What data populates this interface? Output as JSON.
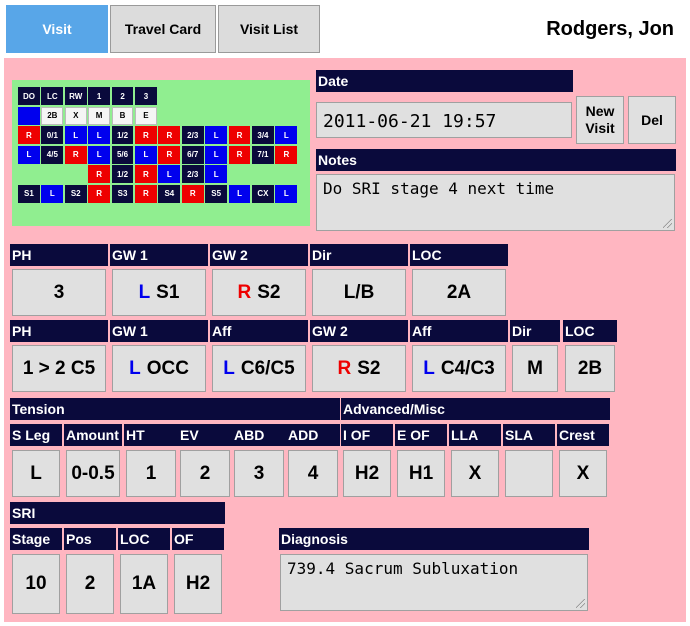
{
  "tabs": [
    "Visit",
    "Travel Card",
    "Visit List"
  ],
  "patient_name": "Rodgers, Jon",
  "travel_card": {
    "rows": [
      [
        [
          "DO",
          "dk"
        ],
        [
          "LC",
          "dk"
        ],
        [
          "RW",
          "dk"
        ],
        [
          "1",
          "dk"
        ],
        [
          "2",
          "dk"
        ],
        [
          "3",
          "dk"
        ]
      ],
      [
        [
          "",
          "bl"
        ],
        [
          "2B",
          "wh"
        ],
        [
          "X",
          "wh"
        ],
        [
          "M",
          "wh"
        ],
        [
          "B",
          "wh"
        ],
        [
          "E",
          "wh"
        ]
      ],
      [
        [
          "R",
          "rd"
        ],
        [
          "0/1",
          "dk"
        ],
        [
          "L",
          "bl"
        ],
        [
          "L",
          "bl"
        ],
        [
          "1/2",
          "dk"
        ],
        [
          "R",
          "rd"
        ],
        [
          "R",
          "rd"
        ],
        [
          "2/3",
          "dk"
        ],
        [
          "L",
          "bl"
        ],
        [
          "R",
          "rd"
        ],
        [
          "3/4",
          "dk"
        ],
        [
          "L",
          "bl"
        ]
      ],
      [
        [
          "L",
          "bl"
        ],
        [
          "4/5",
          "dk"
        ],
        [
          "R",
          "rd"
        ],
        [
          "L",
          "bl"
        ],
        [
          "5/6",
          "dk"
        ],
        [
          "L",
          "bl"
        ],
        [
          "R",
          "rd"
        ],
        [
          "6/7",
          "dk"
        ],
        [
          "L",
          "bl"
        ],
        [
          "R",
          "rd"
        ],
        [
          "7/1",
          "dk"
        ],
        [
          "R",
          "rd"
        ]
      ],
      [
        null,
        null,
        null,
        [
          "R",
          "rd"
        ],
        [
          "1/2",
          "dk"
        ],
        [
          "R",
          "rd"
        ],
        [
          "L",
          "bl"
        ],
        [
          "2/3",
          "dk"
        ],
        [
          "L",
          "bl"
        ],
        null,
        null,
        null
      ],
      [
        [
          "S1",
          "dk"
        ],
        [
          "L",
          "bl"
        ],
        [
          "S2",
          "dk"
        ],
        [
          "R",
          "rd"
        ],
        [
          "S3",
          "dk"
        ],
        [
          "R",
          "rd"
        ],
        [
          "S4",
          "dk"
        ],
        [
          "R",
          "rd"
        ],
        [
          "S5",
          "dk"
        ],
        [
          "L",
          "bl"
        ],
        [
          "CX",
          "dk"
        ],
        [
          "L",
          "bl"
        ]
      ]
    ]
  },
  "date": {
    "label": "Date",
    "value": "2011-06-21 19:57"
  },
  "buttons": {
    "new_visit_line1": "New",
    "new_visit_line2": "Visit",
    "del": "Del"
  },
  "notes": {
    "label": "Notes",
    "value": "Do SRI stage 4 next time"
  },
  "row1": [
    {
      "header": "PH",
      "side": "",
      "value": "3"
    },
    {
      "header": "GW 1",
      "side": "L",
      "value": "S1"
    },
    {
      "header": "GW 2",
      "side": "R",
      "value": "S2"
    },
    {
      "header": "Dir",
      "side": "",
      "value": "L/B"
    },
    {
      "header": "LOC",
      "side": "",
      "value": "2A"
    }
  ],
  "row2": [
    {
      "header": "PH",
      "side": "",
      "value": "1 > 2 C5"
    },
    {
      "header": "GW 1",
      "side": "L",
      "value": "OCC"
    },
    {
      "header": "Aff",
      "side": "L",
      "value": "C6/C5"
    },
    {
      "header": "GW 2",
      "side": "R",
      "value": "S2"
    },
    {
      "header": "Aff",
      "side": "L",
      "value": "C4/C3"
    },
    {
      "header": "Dir",
      "side": "",
      "value": "M"
    },
    {
      "header": "LOC",
      "side": "",
      "value": "2B"
    }
  ],
  "tension": {
    "label": "Tension",
    "cols": [
      {
        "header": "S Leg",
        "value": "L"
      },
      {
        "header": "Amount",
        "value": "0-0.5"
      },
      {
        "header": "HT",
        "value": "1"
      },
      {
        "header": "EV",
        "value": "2"
      },
      {
        "header": "ABD",
        "value": "3"
      },
      {
        "header": "ADD",
        "value": "4"
      }
    ]
  },
  "advanced": {
    "label": "Advanced/Misc",
    "cols": [
      {
        "header": "I OF",
        "value": "H2"
      },
      {
        "header": "E OF",
        "value": "H1"
      },
      {
        "header": "LLA",
        "value": "X"
      },
      {
        "header": "SLA",
        "value": ""
      },
      {
        "header": "Crest",
        "value": "X"
      }
    ]
  },
  "sri": {
    "label": "SRI",
    "cols": [
      {
        "header": "Stage",
        "value": "10"
      },
      {
        "header": "Pos",
        "value": "2"
      },
      {
        "header": "LOC",
        "value": "1A"
      },
      {
        "header": "OF",
        "value": "H2"
      }
    ]
  },
  "diagnosis": {
    "label": "Diagnosis",
    "value": "739.4 Sacrum Subluxation"
  }
}
